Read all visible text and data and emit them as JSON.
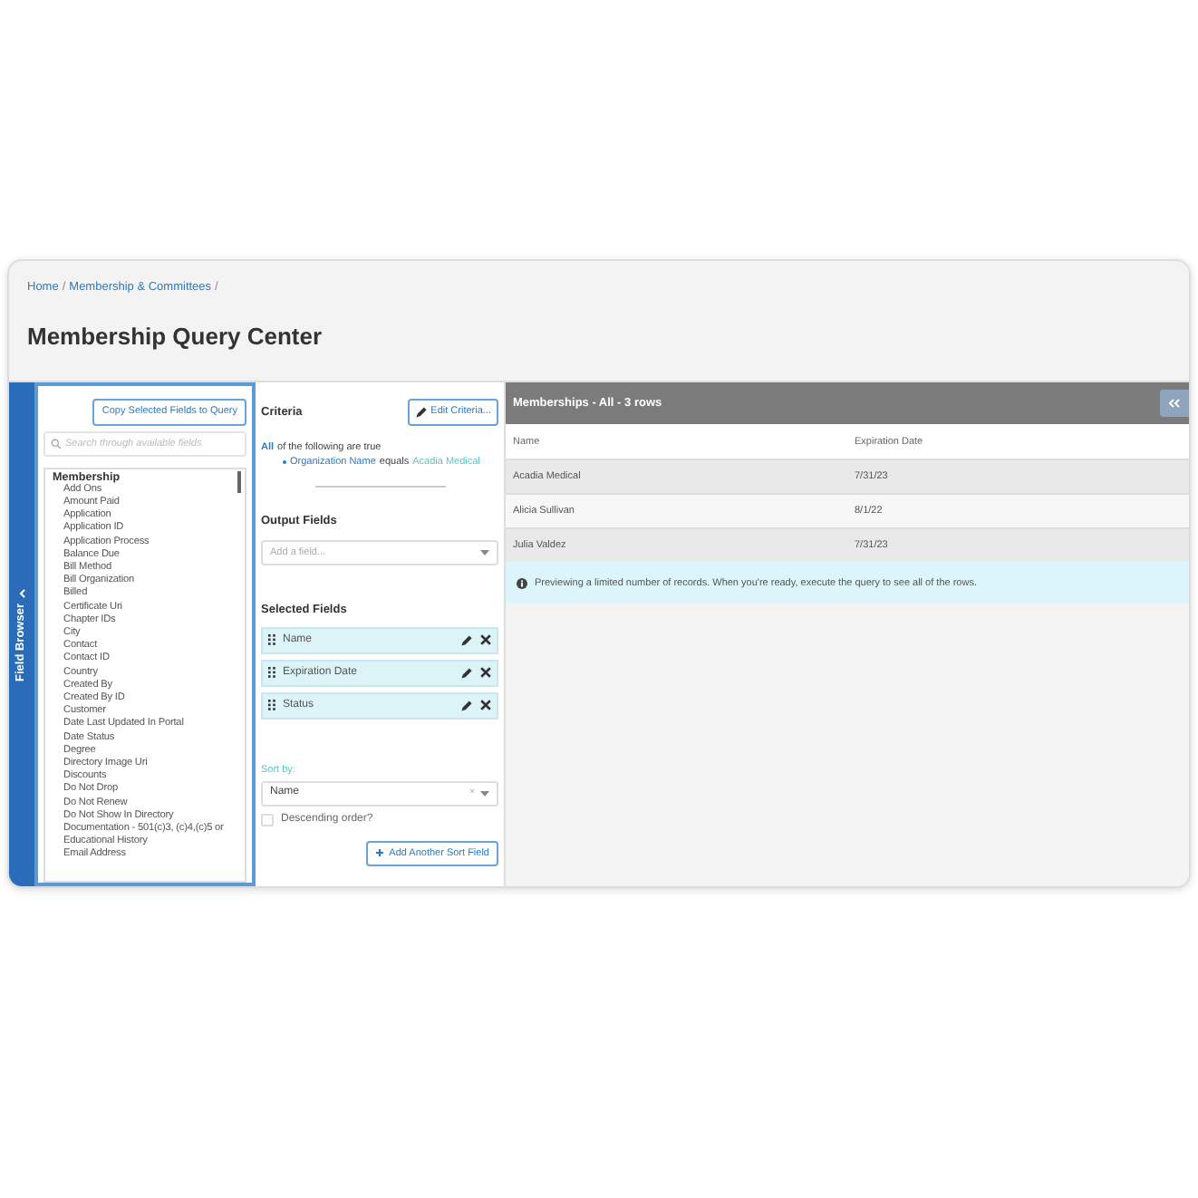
{
  "breadcrumbs": [
    "Home",
    "Membership & Committees"
  ],
  "breadcrumb_separator": "/",
  "title": "Membership Query Center",
  "sidebar_tab": {
    "label": "Field Browser"
  },
  "field_browser": {
    "copy_button": "Copy Selected Fields to Query",
    "search": {
      "placeholder": "Search through available fields"
    },
    "group": "Membership",
    "fields": [
      "Add Ons",
      "Amount Paid",
      "Application",
      "Application ID",
      "Application Process",
      "Balance Due",
      "Bill Method",
      "Bill Organization",
      "Billed",
      "Certificate Uri",
      "Chapter IDs",
      "City",
      "Contact",
      "Contact ID",
      "Country",
      "Created By",
      "Created By ID",
      "Customer",
      "Date Last Updated In Portal",
      "Date Status",
      "Degree",
      "Directory Image Uri",
      "Discounts",
      "Do Not Drop",
      "Do Not Renew",
      "Do Not Show In Directory",
      "Documentation - 501(c)3, (c)4,(c)5 or",
      "Educational History",
      "Email Address"
    ]
  },
  "criteria": {
    "heading": "Criteria",
    "edit_button": "Edit Criteria...",
    "match": "All",
    "match_rest": "of the following are true",
    "conditions": [
      {
        "field": "Organization Name",
        "operator": "equals",
        "value": "Acadia Medical"
      }
    ]
  },
  "output_fields": {
    "heading": "Output Fields",
    "placeholder": "Add a field..."
  },
  "selected_fields": {
    "heading": "Selected Fields",
    "items": [
      "Name",
      "Expiration Date",
      "Status"
    ]
  },
  "sort": {
    "label": "Sort by:",
    "value": "Name",
    "clear": "×",
    "descending_label": "Descending order?",
    "descending": false,
    "add_button": "Add Another Sort Field"
  },
  "results": {
    "title": "Memberships - All - 3 rows",
    "columns": [
      "Name",
      "Expiration Date"
    ],
    "rows": [
      [
        "Acadia Medical",
        "7/31/23"
      ],
      [
        "Alicia Sullivan",
        "8/1/22"
      ],
      [
        "Julia Valdez",
        "7/31/23"
      ]
    ],
    "notice": "Previewing a limited number of records. When you're ready, execute the query to see all of the rows."
  }
}
